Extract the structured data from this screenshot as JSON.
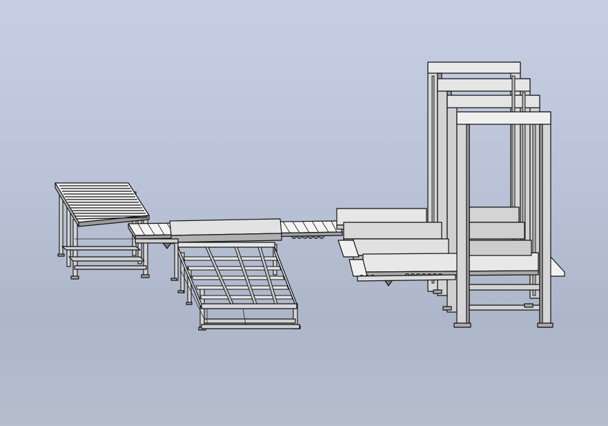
{
  "scene": {
    "type": "cad-3d-viewport",
    "background_gradient": [
      "#c7cfe4",
      "#aeb6c9",
      "#b6bdcd"
    ],
    "line_color": "#111111",
    "part_fill": "#d9d9d9",
    "assemblies": [
      "roller-conveyor-left",
      "belt-conveyor-center",
      "lower-frame-conveyor",
      "gantry-stacker-right"
    ]
  }
}
